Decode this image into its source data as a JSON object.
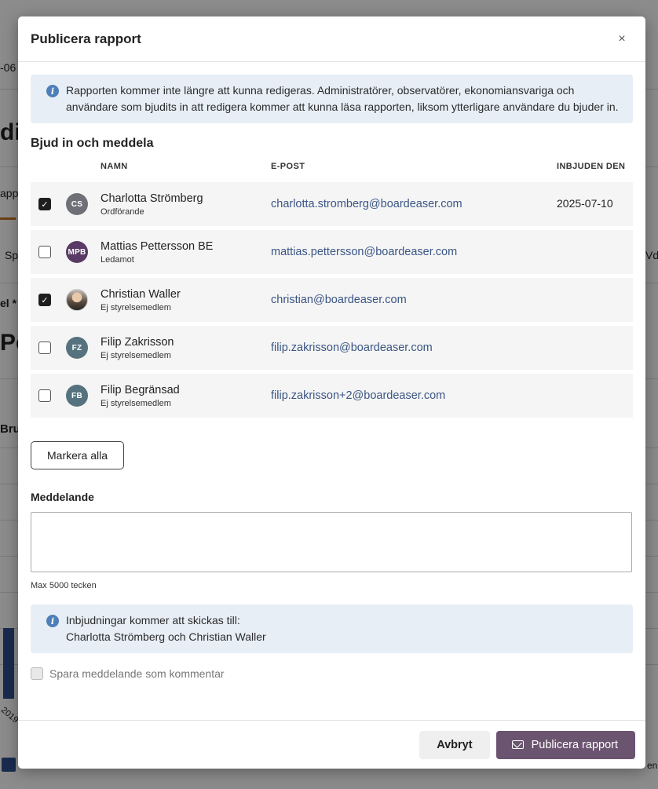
{
  "background": {
    "fragments": [
      "-06",
      "di",
      "app",
      "Sp",
      "el *",
      "Pe",
      "Bru",
      "2019",
      "Vdo",
      "en"
    ]
  },
  "modal": {
    "title": "Publicera rapport",
    "close_label": "×",
    "info_text": "Rapporten kommer inte längre att kunna redigeras. Administratörer, observatörer, ekonomiansvariga och användare som bjudits in att redigera kommer att kunna läsa rapporten, liksom ytterligare användare du bjuder in.",
    "section_title": "Bjud in och meddela",
    "columns": {
      "name": "NAMN",
      "email": "E-POST",
      "invited": "INBJUDEN DEN"
    },
    "rows": [
      {
        "checked": true,
        "initials": "CS",
        "avatar_color": "#6f6f78",
        "name": "Charlotta Strömberg",
        "role": "Ordförande",
        "email": "charlotta.stromberg@boardeaser.com",
        "invited": "2025-07-10"
      },
      {
        "checked": false,
        "initials": "MPB",
        "avatar_color": "#5a3a66",
        "name": "Mattias Pettersson BE",
        "role": "Ledamot",
        "email": "mattias.pettersson@boardeaser.com",
        "invited": ""
      },
      {
        "checked": true,
        "initials": "",
        "avatar_color": "photo",
        "name": "Christian Waller",
        "role": "Ej styrelsemedlem",
        "email": "christian@boardeaser.com",
        "invited": ""
      },
      {
        "checked": false,
        "initials": "FZ",
        "avatar_color": "#55737f",
        "name": "Filip Zakrisson",
        "role": "Ej styrelsemedlem",
        "email": "filip.zakrisson@boardeaser.com",
        "invited": ""
      },
      {
        "checked": false,
        "initials": "FB",
        "avatar_color": "#55737f",
        "name": "Filip Begränsad",
        "role": "Ej styrelsemedlem",
        "email": "filip.zakrisson+2@boardeaser.com",
        "invited": ""
      }
    ],
    "select_all_label": "Markera alla",
    "message_label": "Meddelande",
    "message_value": "",
    "message_hint": "Max 5000 tecken",
    "invite_info_line1": "Inbjudningar kommer att skickas till:",
    "invite_info_line2": "Charlotta Strömberg och Christian Waller",
    "save_comment_label": "Spara meddelande som kommentar",
    "cancel_label": "Avbryt",
    "publish_label": "Publicera rapport"
  }
}
